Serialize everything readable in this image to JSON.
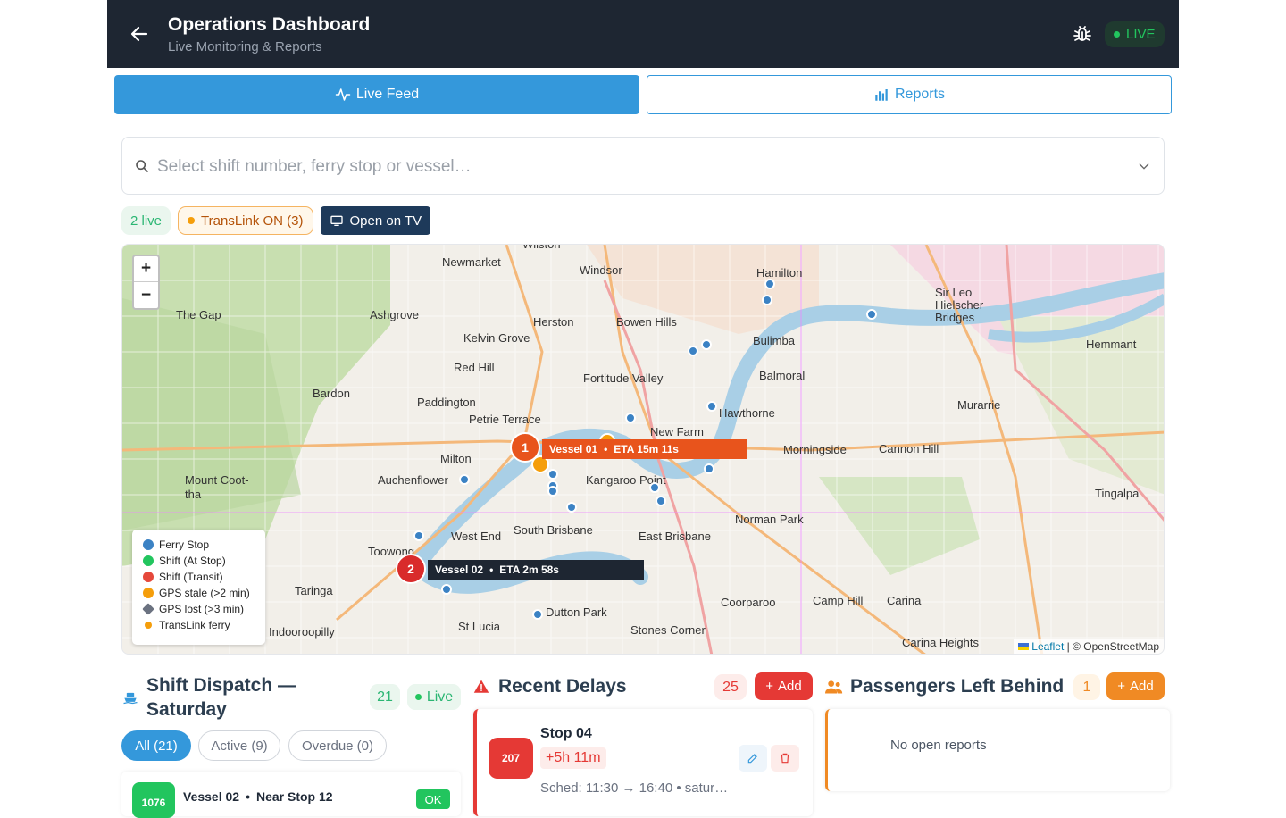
{
  "header": {
    "title": "Operations Dashboard",
    "subtitle": "Live Monitoring & Reports",
    "live_label": "LIVE"
  },
  "tabs": [
    {
      "label": "Live Feed",
      "icon": "activity-icon",
      "active": true
    },
    {
      "label": "Reports",
      "icon": "bar-chart-icon",
      "active": false
    }
  ],
  "search": {
    "placeholder": "Select shift number, ferry stop or vessel…"
  },
  "chips": {
    "live": "2 live",
    "translink": "TransLink ON (3)",
    "tv": "Open on TV"
  },
  "map": {
    "zoom_in": "+",
    "zoom_out": "−",
    "legend": [
      {
        "label": "Ferry Stop",
        "color": "#3b82c4"
      },
      {
        "label": "Shift (At Stop)",
        "color": "#22c55e"
      },
      {
        "label": "Shift (Transit)",
        "color": "#e5483b"
      },
      {
        "label": "GPS stale (>2 min)",
        "color": "#f59e0b"
      },
      {
        "label": "GPS lost (>3 min)",
        "color": "#6b7280"
      },
      {
        "label": "TransLink ferry",
        "color": "#f59e0b"
      }
    ],
    "place_labels": [
      "Wilston",
      "Newmarket",
      "Windsor",
      "Hamilton",
      "Sir Leo Hielscher Bridges",
      "The Gap",
      "Ashgrove",
      "Herston",
      "Bowen Hills",
      "Bulimba",
      "Kelvin Grove",
      "Red Hill",
      "Fortitude Valley",
      "Balmoral",
      "Hemmant",
      "Bardon",
      "Paddington",
      "Petrie Terrace",
      "New Farm",
      "Hawthorne",
      "Murarrie",
      "Milton",
      "Morningside",
      "Cannon Hill",
      "Mount Coot-tha",
      "Auchenflower",
      "Kangaroo Point",
      "Tingalpa",
      "West End",
      "South Brisbane",
      "East Brisbane",
      "Norman Park",
      "Toowong",
      "Taringa",
      "Dutton Park",
      "Coorparoo",
      "Camp Hill",
      "Carina",
      "Indooroopilly",
      "St Lucia",
      "Stones Corner",
      "Carina Heights"
    ],
    "vessels": [
      {
        "number": "1",
        "name": "Vessel 01",
        "eta": "ETA 15m 11s",
        "color": "#e8541c"
      },
      {
        "number": "2",
        "name": "Vessel 02",
        "eta": "ETA 2m 58s",
        "color": "#d92b2b"
      }
    ],
    "separator": "•",
    "attribution_leaflet": "Leaflet",
    "attribution_osm": "| © OpenStreetMap"
  },
  "shift_dispatch": {
    "title": "Shift Dispatch — Saturday",
    "count": "21",
    "live": "Live",
    "filters": [
      "All (21)",
      "Active (9)",
      "Overdue (0)"
    ],
    "row": {
      "badge": "1076",
      "vessel": "Vessel 02",
      "location": "Near Stop 12",
      "status": "OK"
    }
  },
  "recent_delays": {
    "title": "Recent Delays",
    "count": "25",
    "add": "Add",
    "item": {
      "number": "207",
      "stop": "Stop 04",
      "delay": "+5h 11m",
      "sched": "Sched: 11:30 → 16:40 • satur…"
    }
  },
  "left_behind": {
    "title": "Passengers Left Behind",
    "count": "1",
    "add": "Add",
    "empty": "No open reports"
  },
  "colors": {
    "header": "#1e2632",
    "primary": "#3498db",
    "danger": "#e53935",
    "warning": "#f08a24",
    "success": "#22c55e"
  }
}
